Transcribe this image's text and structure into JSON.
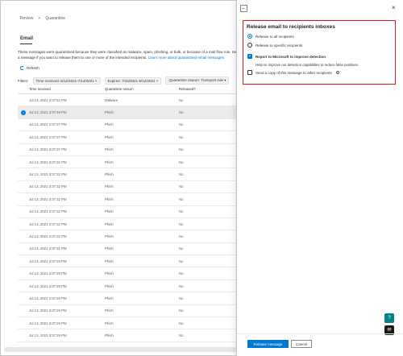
{
  "breadcrumb": [
    "Review",
    ">",
    "Quarantine"
  ],
  "page": {
    "tab": "Email",
    "description": "These messages were quarantined because they were classified as malware, spam, phishing, or bulk, or because of a mail flow rule. Select a message if you want to release them to one or more of the intended recipients.",
    "learn_more": "Learn more about quarantined email messages",
    "refresh": "Refresh",
    "filters_label": "Filters:",
    "filters": [
      "Time received: 6/12/2021-7/14/2021 ×",
      "Expires: 7/15/2021-8/12/2021 ×",
      "Quarantine reason: Transport rule ▾"
    ]
  },
  "table": {
    "columns": [
      "Time received",
      "Quarantine reason",
      "Released?"
    ],
    "rows": [
      {
        "time": "Jul 13, 2021 3:37:52 PM",
        "reason": "Malware",
        "released": "No",
        "selected": false
      },
      {
        "time": "Jul 13, 2021 3:37:49 PM",
        "reason": "Phish",
        "released": "No",
        "selected": true
      },
      {
        "time": "Jul 13, 2021 3:37:37 PM",
        "reason": "Phish",
        "released": "No",
        "selected": false
      },
      {
        "time": "Jul 13, 2021 3:37:37 PM",
        "reason": "Phish",
        "released": "No",
        "selected": false
      },
      {
        "time": "Jul 13, 2021 3:37:37 PM",
        "reason": "Phish",
        "released": "No",
        "selected": false
      },
      {
        "time": "Jul 13, 2021 3:37:32 PM",
        "reason": "Phish",
        "released": "No",
        "selected": false
      },
      {
        "time": "Jul 13, 2021 3:37:32 PM",
        "reason": "Phish",
        "released": "No",
        "selected": false
      },
      {
        "time": "Jul 13, 2021 3:37:32 PM",
        "reason": "Phish",
        "released": "No",
        "selected": false
      },
      {
        "time": "Jul 13, 2021 3:37:32 PM",
        "reason": "Phish",
        "released": "No",
        "selected": false
      },
      {
        "time": "Jul 13, 2021 3:37:32 PM",
        "reason": "Phish",
        "released": "No",
        "selected": false
      },
      {
        "time": "Jul 13, 2021 3:37:32 PM",
        "reason": "Phish",
        "released": "No",
        "selected": false
      },
      {
        "time": "Jul 13, 2021 3:37:32 PM",
        "reason": "Phish",
        "released": "No",
        "selected": false
      },
      {
        "time": "Jul 13, 2021 3:37:31 PM",
        "reason": "Phish",
        "released": "No",
        "selected": false
      },
      {
        "time": "Jul 13, 2021 3:37:29 PM",
        "reason": "Phish",
        "released": "No",
        "selected": false
      },
      {
        "time": "Jul 13, 2021 3:37:29 PM",
        "reason": "Phish",
        "released": "No",
        "selected": false
      },
      {
        "time": "Jul 13, 2021 3:37:29 PM",
        "reason": "Phish",
        "released": "No",
        "selected": false
      },
      {
        "time": "Jul 13, 2021 3:37:29 PM",
        "reason": "Phish",
        "released": "No",
        "selected": false
      },
      {
        "time": "Jul 13, 2021 3:37:29 PM",
        "reason": "Phish",
        "released": "No",
        "selected": false
      },
      {
        "time": "Jul 13, 2021 3:37:29 PM",
        "reason": "Phish",
        "released": "No",
        "selected": false
      },
      {
        "time": "Jul 13, 2021 3:37:29 PM",
        "reason": "Phish",
        "released": "No",
        "selected": false
      }
    ]
  },
  "panel": {
    "back_icon": "←",
    "close_icon": "×",
    "title": "Release email to recipients inboxes",
    "release_all": "Release to all recipients",
    "release_specific": "Release to specific recipients",
    "report": "Report to Microsoft to improve detection",
    "report_help": "Help us improve our detection capabilities to reduce false positives.",
    "send_copy": "Send a copy of this message to other recipients",
    "release_button": "Release message",
    "cancel_button": "Cancel"
  },
  "colors": {
    "accent": "#0078d4",
    "highlight_box": "#d9191c",
    "help_fab": "#038387",
    "feedback_fab": "#1b1a19"
  }
}
